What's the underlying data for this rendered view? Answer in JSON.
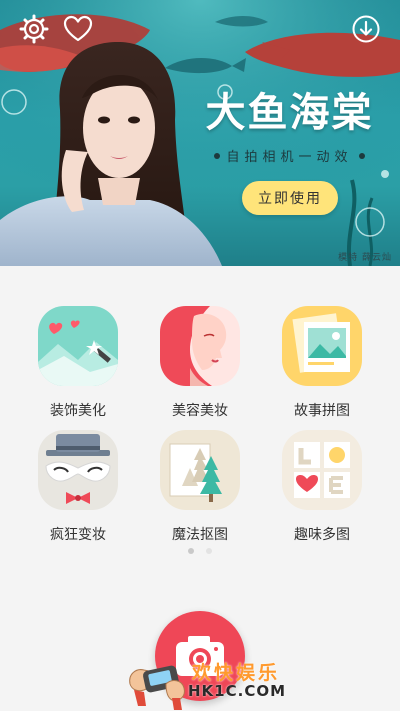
{
  "banner": {
    "title": "大鱼海棠",
    "subtitle": "自拍相机一动效",
    "cta_label": "立即使用",
    "credit": "模特 薛云灿"
  },
  "top_bar": {
    "settings_icon": "gear-icon",
    "favorite_icon": "heart-icon",
    "download_icon": "download-icon"
  },
  "features": [
    {
      "label": "装饰美化",
      "icon": "decorate-icon"
    },
    {
      "label": "美容美妆",
      "icon": "beauty-makeup-icon"
    },
    {
      "label": "故事拼图",
      "icon": "story-collage-icon"
    },
    {
      "label": "疯狂变妆",
      "icon": "crazy-makeover-icon"
    },
    {
      "label": "魔法抠图",
      "icon": "magic-cutout-icon"
    },
    {
      "label": "趣味多图",
      "icon": "fun-multi-photo-icon"
    }
  ],
  "pager": {
    "count": 2,
    "active_index": 0,
    "active_color": "#c9c9c9",
    "inactive_color": "#e3e3e3"
  },
  "camera": {
    "icon": "camera-icon",
    "color": "#ef4757"
  },
  "watermark": {
    "cn": "欢快娱乐",
    "en": "HK1C.COM"
  }
}
